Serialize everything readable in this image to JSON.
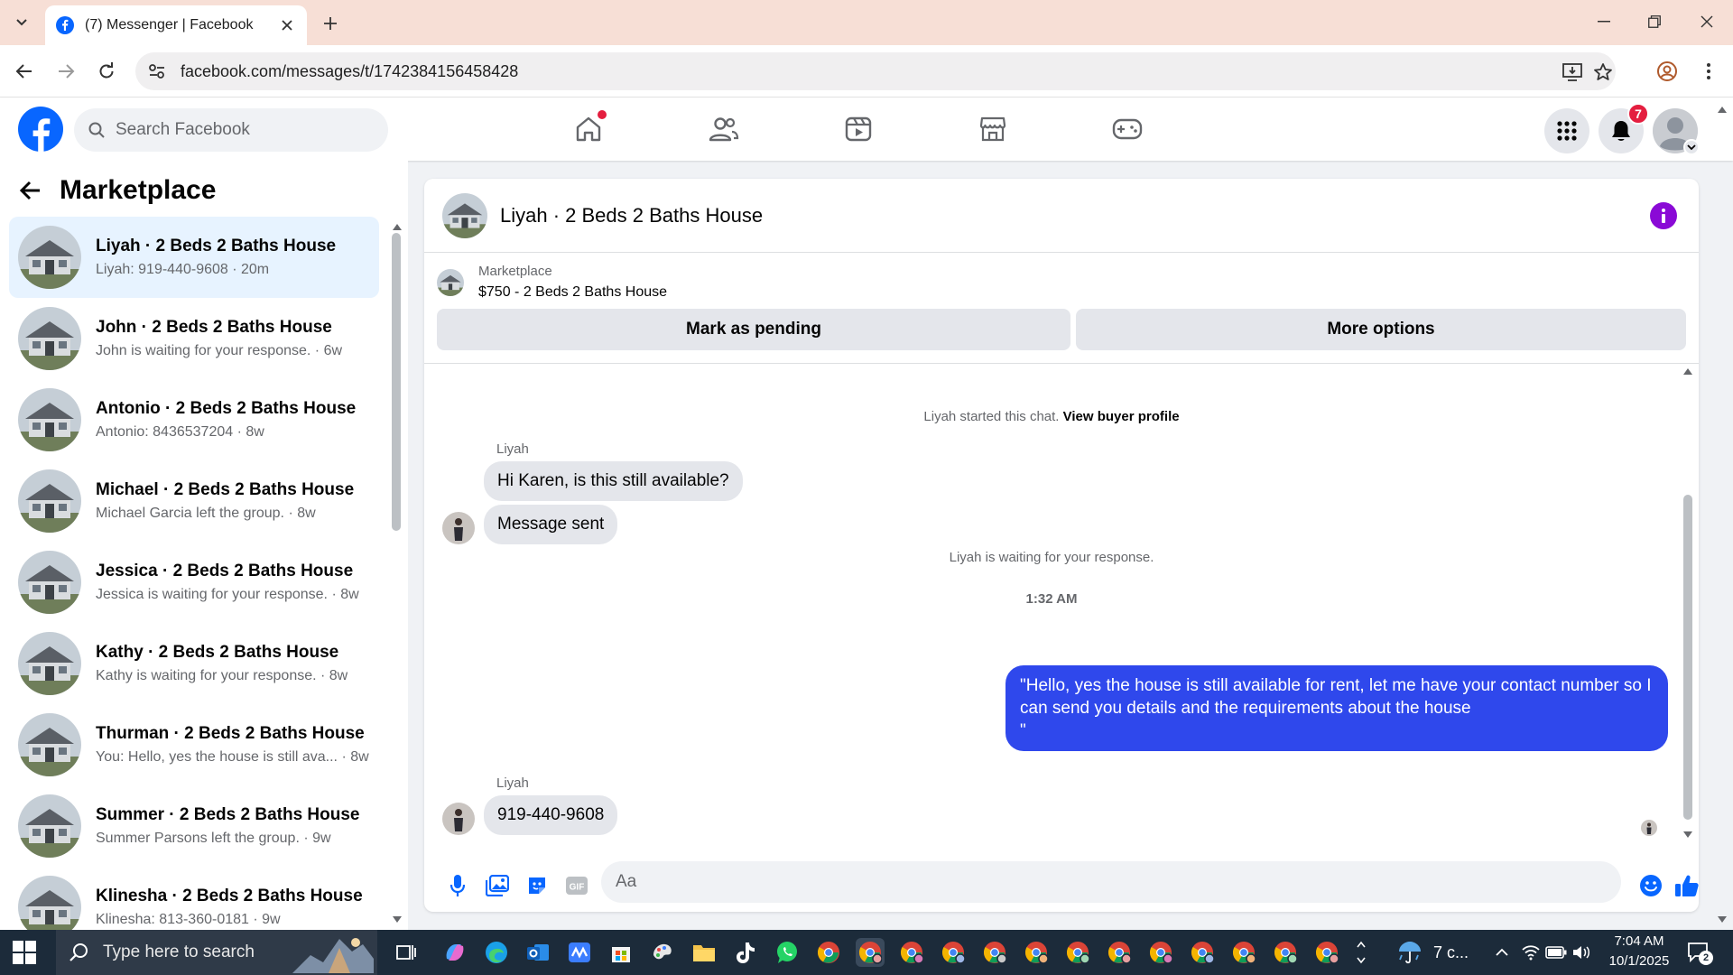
{
  "browser": {
    "tab_title": "(7) Messenger | Facebook",
    "url": "facebook.com/messages/t/1742384156458428"
  },
  "fb": {
    "search_placeholder": "Search Facebook",
    "notifications_count": "7"
  },
  "sidebar": {
    "title": "Marketplace",
    "items": [
      {
        "name": "Liyah · 2 Beds 2 Baths House",
        "sub": "Liyah: 919-440-9608 · 20m"
      },
      {
        "name": "John · 2 Beds 2 Baths House",
        "sub": "John is waiting for your response. · 6w"
      },
      {
        "name": "Antonio · 2 Beds 2 Baths House",
        "sub": "Antonio: 8436537204 · 8w"
      },
      {
        "name": "Michael · 2 Beds 2 Baths House",
        "sub": "Michael Garcia left the group. · 8w"
      },
      {
        "name": "Jessica · 2 Beds 2 Baths House",
        "sub": "Jessica is waiting for your response. · 8w"
      },
      {
        "name": "Kathy · 2 Beds 2 Baths House",
        "sub": "Kathy is waiting for your response. · 8w"
      },
      {
        "name": "Thurman · 2 Beds 2 Baths House",
        "sub": "You: Hello, yes the house is still ava... · 8w"
      },
      {
        "name": "Summer · 2 Beds 2 Baths House",
        "sub": "Summer Parsons left the group. · 9w"
      },
      {
        "name": "Klinesha · 2 Beds 2 Baths House",
        "sub": "Klinesha: 813-360-0181 · 9w"
      }
    ]
  },
  "chat": {
    "title": "Liyah · 2 Beds 2 Baths House",
    "listing_label": "Marketplace",
    "listing_price": "$750 - 2 Beds 2 Baths House",
    "mark_pending": "Mark as pending",
    "more_options": "More options",
    "started": "Liyah started this chat.",
    "view_profile": "View buyer profile",
    "sender1": "Liyah",
    "msg1": "Hi Karen, is this still available?",
    "msg2": "Message sent",
    "waiting": "Liyah is waiting for your response.",
    "time": "1:32 AM",
    "outgoing": "\"Hello, yes the house is still available for rent, let me have your contact number so I can send you details and the requirements about the house\n\"",
    "sender2": "Liyah",
    "msg3": "919-440-9608",
    "composer_placeholder": "Aa"
  },
  "taskbar": {
    "search_text": "Type here to search",
    "weather": "7 c...",
    "time": "7:04 AM",
    "date": "10/1/2025",
    "notif_count": "2"
  },
  "colors": {
    "fb_blue": "#0866ff",
    "outgoing_bubble": "#2f48ec",
    "info_purple": "#8a0ad6",
    "badge_red": "#e41e3f"
  }
}
